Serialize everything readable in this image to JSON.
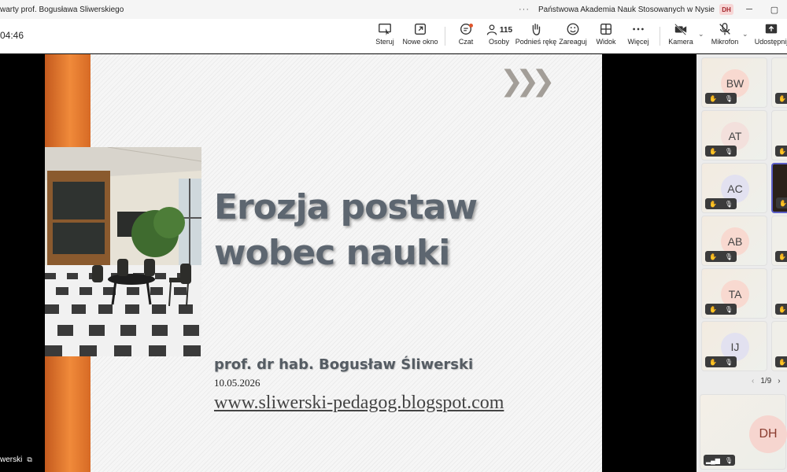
{
  "window": {
    "title": "warty prof. Bogusława Śliwerskiego",
    "organization": "Państwowa Akademia Nauk Stosowanych w Nysie",
    "user_initials": "DH",
    "more": "···"
  },
  "toolbar": {
    "timer": "04:46",
    "control": "Steruj",
    "new_window": "Nowe okno",
    "chat": "Czat",
    "people": "Osoby",
    "people_count": "115",
    "raise_hand": "Podnieś rękę",
    "react": "Zareaguj",
    "view": "Widok",
    "more": "Więcej",
    "camera": "Kamera",
    "mic": "Mikrofon",
    "share": "Udostępnij"
  },
  "slide": {
    "title_line1": "Erozja postaw",
    "title_line2": "wobec nauki",
    "author": "prof.  dr hab. Bogusław Śliwerski",
    "date": "10.05.2026",
    "url": "www.sliwerski-pedagog.blogspot.com",
    "arrows": "❯❯❯"
  },
  "presenter": {
    "name": "werski"
  },
  "gallery": {
    "participants": [
      {
        "initials": "BW",
        "color": "#f8d9d0"
      },
      {
        "initials": "AT",
        "color": "#f3e0dc"
      },
      {
        "initials": "AC",
        "color": "#e2e1f0"
      },
      {
        "initials": "AB",
        "color": "#f8d9d0"
      },
      {
        "initials": "TA",
        "color": "#f8d9d0"
      },
      {
        "initials": "IJ",
        "color": "#e2e1f0"
      }
    ],
    "pager": "1/9",
    "prev": "‹",
    "next": "›",
    "self_initials": "DH"
  }
}
